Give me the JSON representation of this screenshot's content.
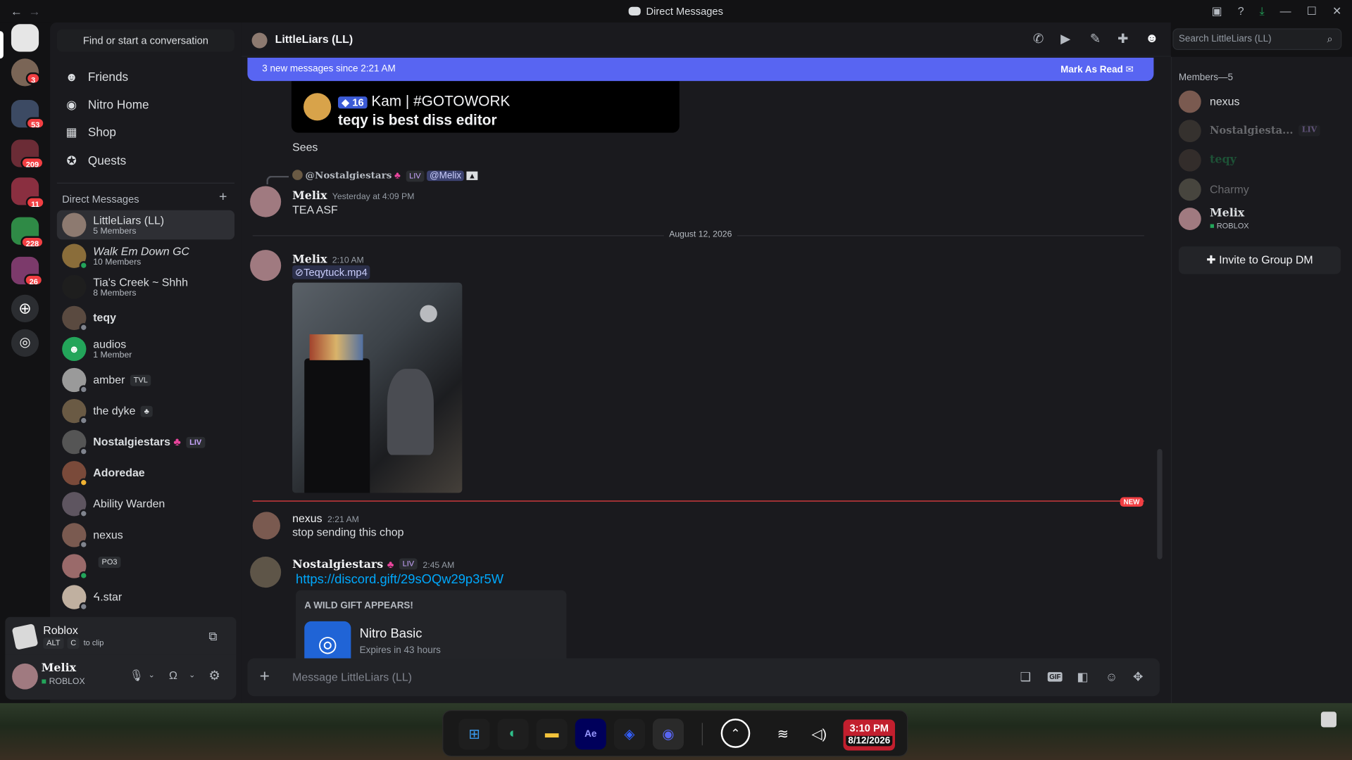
{
  "window": {
    "title": "Direct Messages"
  },
  "guild_badges": [
    "3",
    "53",
    "209",
    "11",
    "228",
    "26"
  ],
  "sidebar": {
    "search_placeholder": "Find or start a conversation",
    "nav": [
      "Friends",
      "Nitro Home",
      "Shop",
      "Quests"
    ],
    "dm_header": "Direct Messages",
    "dms": [
      {
        "name": "LittleLiars (LL)",
        "sub": "5 Members"
      },
      {
        "name": "Walk Em Down GC",
        "sub": "10 Members"
      },
      {
        "name": "Tia's Creek ~ Shhh",
        "sub": "8 Members"
      },
      {
        "name": "teqy",
        "sub": ""
      },
      {
        "name": "audios",
        "sub": "1 Member"
      },
      {
        "name": "amber",
        "tag": "TVL"
      },
      {
        "name": "the dyke",
        "tag": "♣"
      },
      {
        "name": "Nostalgiestars",
        "tag": "LIV"
      },
      {
        "name": "Adoredae"
      },
      {
        "name": "Ability Warden"
      },
      {
        "name": "nexus"
      },
      {
        "name": "",
        "tag": "PO3"
      },
      {
        "name": "ᔦ.star"
      }
    ]
  },
  "activity": {
    "title": "Roblox",
    "hint_key1": "ALT",
    "hint_key2": "C",
    "hint_text": "to clip"
  },
  "user": {
    "name": "Melix",
    "status": "ROBLOX"
  },
  "channel": {
    "name": "LittleLiars (LL)",
    "search_placeholder": "Search LittleLiars (LL)"
  },
  "banner": {
    "text": "3 new messages since 2:21 AM",
    "action": "Mark As Read"
  },
  "messages": {
    "embed_badge": "16",
    "embed_title": "Kam | #GOTOWORK",
    "embed_body": "teqy is best diss editor",
    "sees": "Sees",
    "reply_author": "@Nostalgiestars",
    "reply_tag": "LIV",
    "reply_mention": "@Melix",
    "m1_author": "Melix",
    "m1_time": "Yesterday at 4:09 PM",
    "m1_text": "TEA ASF",
    "date_divider": "August 12, 2026",
    "m2_author": "Melix",
    "m2_time": "2:10 AM",
    "m2_file": "Teqytuck.mp4",
    "new_label": "NEW",
    "m3_author": "nexus",
    "m3_time": "2:21 AM",
    "m3_text": "stop sending this chop",
    "m4_author": "Nostalgiestars",
    "m4_tag": "LIV",
    "m4_time": "2:45 AM",
    "m4_link": "https://discord.gift/29sOQw29p3r5W",
    "gift_header": "A WILD GIFT APPEARS!",
    "gift_title": "Nitro Basic",
    "gift_sub": "Expires in 43 hours"
  },
  "composer": {
    "placeholder": "Message LittleLiars (LL)",
    "gif": "GIF"
  },
  "members": {
    "header": "Members—5",
    "list": [
      {
        "name": "nexus"
      },
      {
        "name": "Nostalgiesta...",
        "tag": "LIV"
      },
      {
        "name": "teqy"
      },
      {
        "name": "Charmy"
      },
      {
        "name": "Melix",
        "sub": "ROBLOX"
      }
    ],
    "invite": "Invite to Group DM"
  },
  "taskbar": {
    "time": "3:10 PM",
    "date": "8/12/2026"
  }
}
